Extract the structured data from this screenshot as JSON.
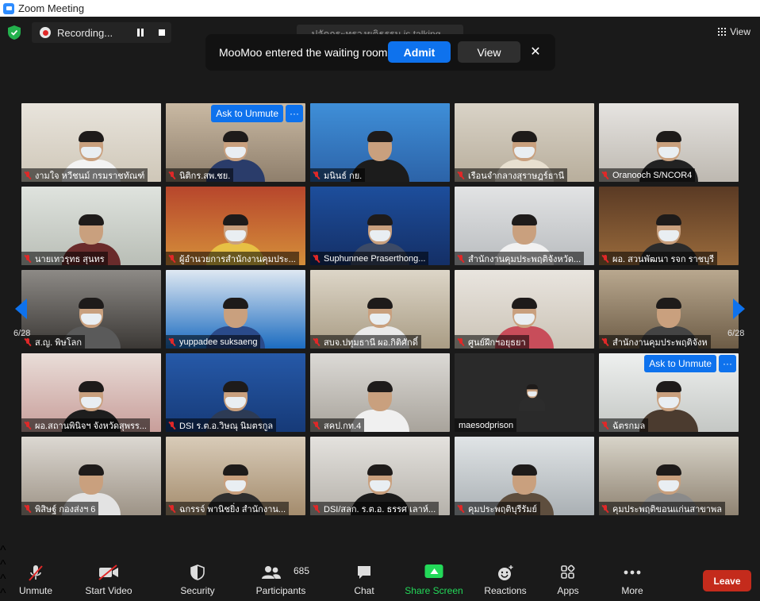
{
  "window": {
    "title": "Zoom Meeting"
  },
  "top_bar": {
    "recording_label": "Recording...",
    "talking_label": "ปลัดกระทรวงยุติธรรม is talking...",
    "view_label": "View"
  },
  "waiting_room": {
    "message": "MooMoo entered the waiting room",
    "admit_label": "Admit",
    "view_label": "View"
  },
  "gallery": {
    "page_left": "6/28",
    "page_right": "6/28",
    "ask_to_unmute_label": "Ask to Unmute",
    "more_label": "···",
    "tiles": [
      {
        "name": "งามใจ หวีชนม์ กรมราชทัณฑ์",
        "muted": true
      },
      {
        "name": "นิติกร.สพ.ชย.",
        "muted": true
      },
      {
        "name": "มนินธ์ กย.",
        "muted": true
      },
      {
        "name": "เรือนจำกลางสุราษฎร์ธานี",
        "muted": true
      },
      {
        "name": "Oranooch S/NCOR4",
        "muted": true
      },
      {
        "name": "นายเทวรุทธ สุนทร",
        "muted": true
      },
      {
        "name": "ผู้อำนวยการสำนักงานคุมประ...",
        "muted": true
      },
      {
        "name": "Suphunnee Praserthong...",
        "muted": true
      },
      {
        "name": "สำนักงานคุมประพฤติจังหวัด...",
        "muted": true
      },
      {
        "name": "ผอ. สวนพัฒนา รจก ราชบุรี",
        "muted": true
      },
      {
        "name": "ส.ญ. พิษโลก",
        "muted": true
      },
      {
        "name": "yuppadee suksaeng",
        "muted": true
      },
      {
        "name": "สบจ.ปทุมธานี ผอ.กิติศักดิ์",
        "muted": true
      },
      {
        "name": "ศูนย์ฝึกฯอยุธยา",
        "muted": true
      },
      {
        "name": "สำนักงานคุมประพฤติจังห",
        "muted": true
      },
      {
        "name": "ผอ.สถานพินิจฯ จังหวัดสุพรร...",
        "muted": true
      },
      {
        "name": "DSI ร.ต.อ.วิษณุ นิมตรกูล",
        "muted": true
      },
      {
        "name": "สคป.กท.4",
        "muted": true
      },
      {
        "name": "maesodprison",
        "muted": false
      },
      {
        "name": "ฉัตรกมล",
        "muted": true
      },
      {
        "name": "พิสิษฐ์ กองส่งฯ 6",
        "muted": true
      },
      {
        "name": "ฉกรรจ์ พานิชยิ่ง สำนักงาน...",
        "muted": true
      },
      {
        "name": "DSI/สลก. ร.ต.อ. ธรรศ เลาห์...",
        "muted": true
      },
      {
        "name": "คุมประพฤติบุรีรัมย์",
        "muted": true
      },
      {
        "name": "คุมประพฤติขอนแก่นสาขาพล",
        "muted": true
      }
    ]
  },
  "toolbar": {
    "unmute": "Unmute",
    "start_video": "Start Video",
    "security": "Security",
    "participants": "Participants",
    "participants_count": "685",
    "chat": "Chat",
    "share_screen": "Share Screen",
    "reactions": "Reactions",
    "apps": "Apps",
    "more": "More",
    "leave": "Leave"
  },
  "colors": {
    "accent": "#0e72ed",
    "share_green": "#23d959",
    "leave_red": "#c42b1c",
    "mute_red": "#e02828"
  }
}
